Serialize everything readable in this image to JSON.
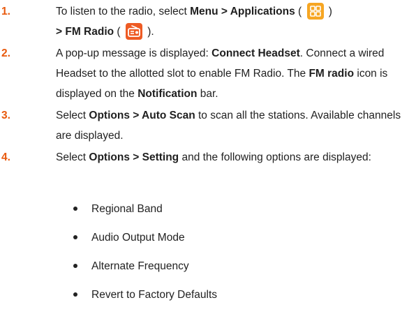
{
  "steps": [
    {
      "number": "1.",
      "line1_pre": "To listen to the radio, select ",
      "line1_bold": "Menu > Applications",
      "line1_paren_open": " ( ",
      "apps_icon": "applications-grid-icon",
      "line1_paren_close": " )",
      "line2_bold": "> FM Radio",
      "line2_paren_open": " ( ",
      "radio_icon": "fm-radio-app-icon",
      "line2_paren_close": " )."
    },
    {
      "number": "2.",
      "t1": "A pop-up message is displayed: ",
      "b1": "Connect Headset",
      "t2": ". Connect a wired Headset to the allotted slot to enable FM Radio. The ",
      "b2": "FM radio",
      "t3": " icon is displayed on the ",
      "b3": "Notification",
      "t4": " bar."
    },
    {
      "number": "3.",
      "t1": "Select ",
      "b1": "Options > Auto Scan",
      "t2": " to scan all the stations. Available channels are displayed."
    },
    {
      "number": "4.",
      "t1": "Select ",
      "b1": "Options > Setting",
      "t2": " and the following options are displayed:"
    }
  ],
  "options": [
    "Regional Band",
    "Audio Output Mode",
    "Alternate Frequency",
    "Revert to Factory Defaults"
  ],
  "colors": {
    "step_number": "#e8590c",
    "apps_icon": "#f6a623",
    "radio_icon": "#ee5b24"
  }
}
